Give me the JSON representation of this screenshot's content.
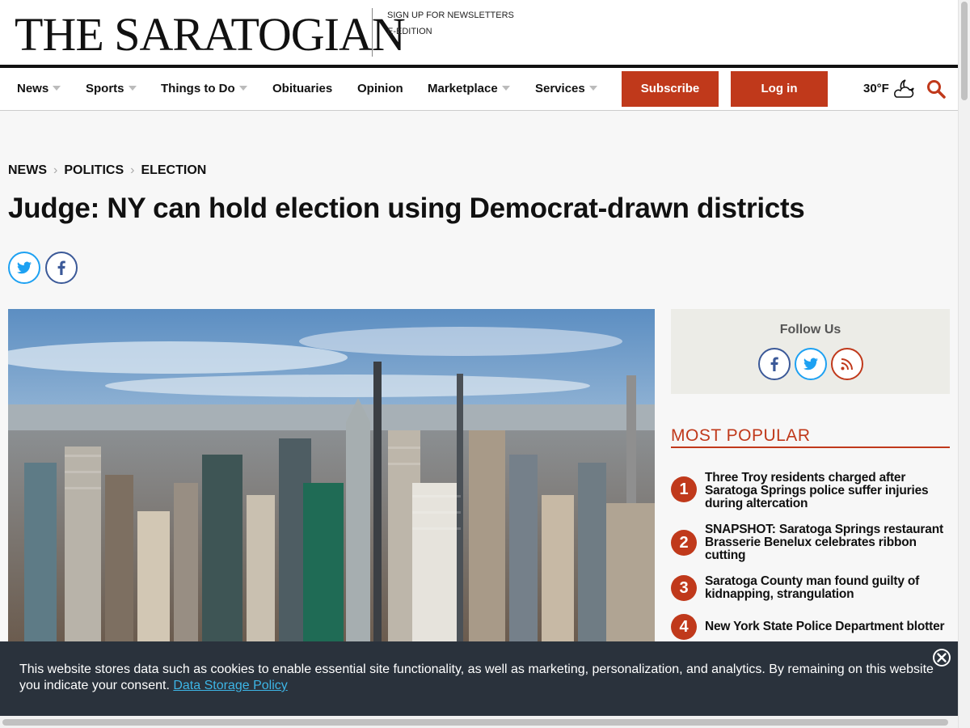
{
  "header": {
    "logo": "THE SARATOGIAN",
    "links": [
      "SIGN UP FOR NEWSLETTERS",
      "E-EDITION"
    ]
  },
  "nav": {
    "items": [
      "News",
      "Sports",
      "Things to Do",
      "Obituaries",
      "Opinion",
      "Marketplace",
      "Services"
    ],
    "subscribe": "Subscribe",
    "login": "Log in",
    "weather": "30°F",
    "weather_icon": "partly-cloudy-night-icon",
    "search_icon": "search-icon"
  },
  "breadcrumb": [
    "NEWS",
    "POLITICS",
    "ELECTION"
  ],
  "article": {
    "headline": "Judge: NY can hold election using Democrat-drawn districts"
  },
  "sidebar": {
    "follow_title": "Follow Us",
    "most_popular_title": "MOST POPULAR",
    "most_popular": [
      {
        "rank": "1",
        "title": "Three Troy residents charged after Saratoga Springs police suffer injuries during altercation"
      },
      {
        "rank": "2",
        "title": "SNAPSHOT: Saratoga Springs restaurant Brasserie Benelux celebrates ribbon cutting"
      },
      {
        "rank": "3",
        "title": "Saratoga County man found guilty of kidnapping, strangulation"
      },
      {
        "rank": "4",
        "title": "New York State Police Department blotter"
      }
    ]
  },
  "cookie": {
    "text": "This website stores data such as cookies to enable essential site functionality, as well as marketing, personalization, and analytics. By remaining on this website you indicate your consent.",
    "link": "Data Storage Policy"
  },
  "colors": {
    "accent": "#c0391b",
    "twitter": "#1da1f2",
    "facebook": "#3b5998",
    "cookie_bg": "#2a323c"
  }
}
